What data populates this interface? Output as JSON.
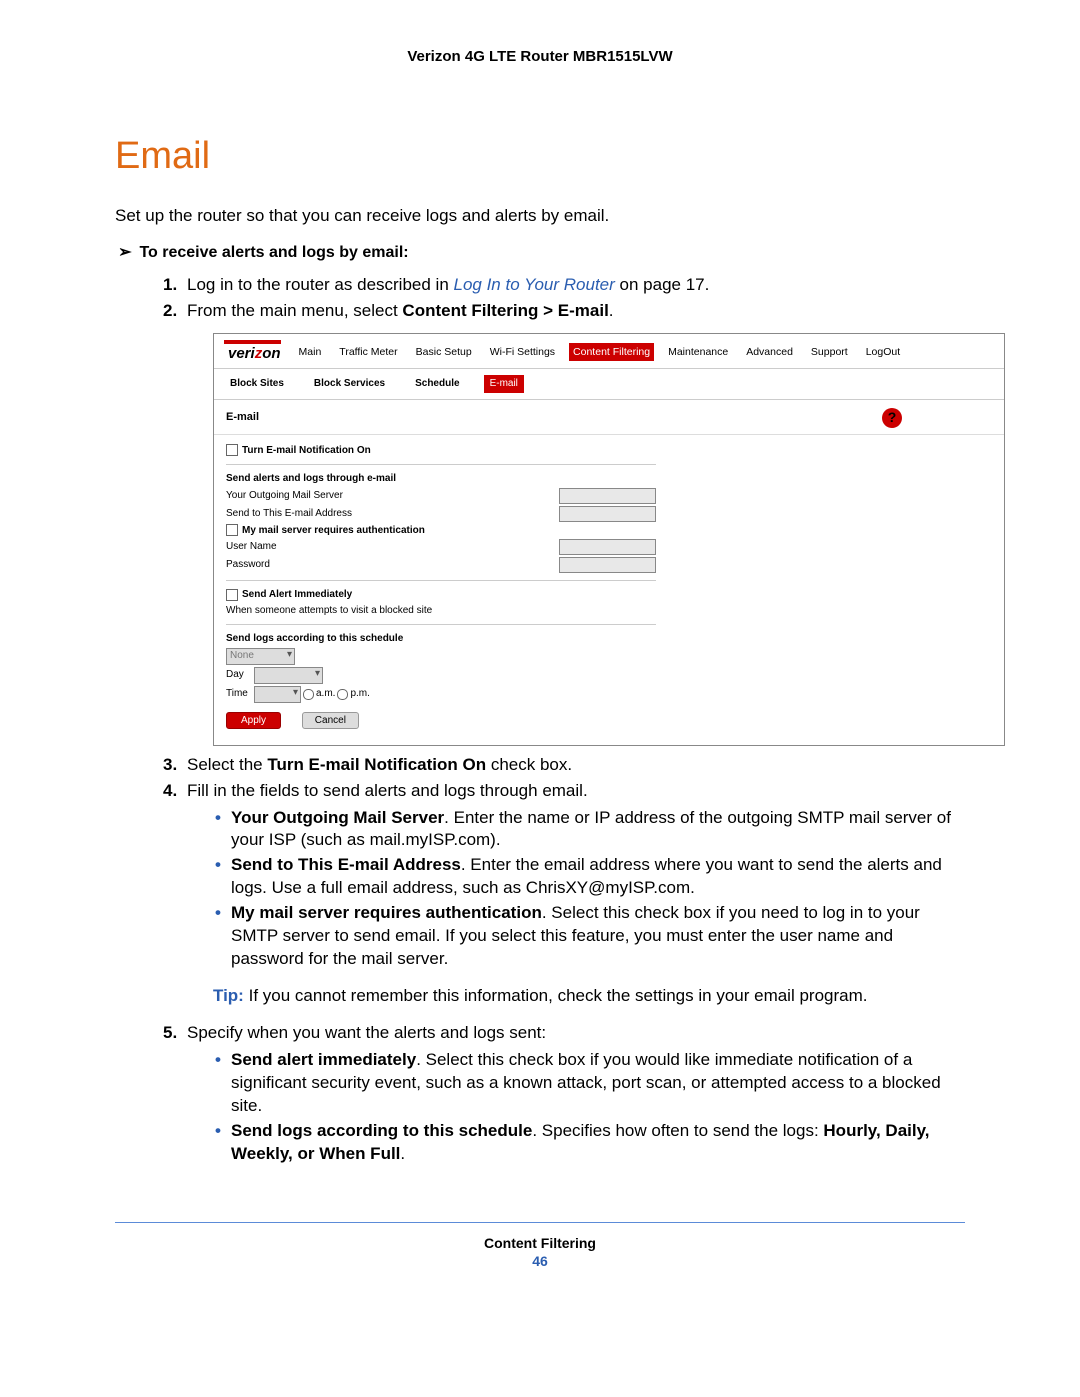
{
  "doc_header": "Verizon 4G LTE Router MBR1515LVW",
  "title": "Email",
  "intro": "Set up the router so that you can receive logs and alerts by email.",
  "task_heading": "To receive alerts and logs by email:",
  "steps": {
    "s1_a": "Log in to the router as described in ",
    "s1_link": "Log In to Your Router",
    "s1_b": " on page 17.",
    "s2_a": "From the main menu, select ",
    "s2_bold": "Content Filtering > E-mail",
    "s2_b": ".",
    "s3_a": "Select the ",
    "s3_bold": "Turn E-mail Notification On",
    "s3_b": " check box.",
    "s4": "Fill in the fields to send alerts and logs through email.",
    "s5": "Specify when you want the alerts and logs sent:"
  },
  "bullets4": {
    "b1_bold": "Your Outgoing Mail Server",
    "b1_txt": ". Enter the name or IP address of the outgoing SMTP mail server of your ISP (such as mail.myISP.com).",
    "b2_bold": "Send to This E-mail Address",
    "b2_txt": ". Enter the email address where you want to send the alerts and logs. Use a full email address, such as ChrisXY@myISP.com.",
    "b3_bold": "My mail server requires authentication",
    "b3_txt": ". Select this check box if you need to log in to your SMTP server to send email. If you select this feature, you must enter the user name and password for the mail server."
  },
  "tip_label": "Tip:",
  "tip_text": "If you cannot remember this information, check the settings in your email program.",
  "bullets5": {
    "b1_bold": "Send alert immediately",
    "b1_txt": ". Select this check box if you would like immediate notification of a significant security event, such as a known attack, port scan, or attempted access to a blocked site.",
    "b2_bold": "Send logs according to this schedule",
    "b2_txt": ". Specifies how often to send the logs: ",
    "b2_opts": "Hourly, Daily, Weekly, or When Full"
  },
  "footer_section": "Content Filtering",
  "page_number": "46",
  "ss": {
    "logo_a": "veri",
    "logo_b": "z",
    "logo_c": "on",
    "nav": [
      "Main",
      "Traffic Meter",
      "Basic Setup",
      "Wi-Fi Settings",
      "Content Filtering",
      "Maintenance",
      "Advanced",
      "Support",
      "LogOut"
    ],
    "subnav": [
      "Block Sites",
      "Block Services",
      "Schedule",
      "E-mail"
    ],
    "panel_title": "E-mail",
    "help": "?",
    "turn_on": "Turn E-mail Notification On",
    "send_heading": "Send alerts and logs through e-mail",
    "out_server": "Your Outgoing Mail Server",
    "send_to": "Send to This E-mail Address",
    "auth": "My mail server requires authentication",
    "user": "User Name",
    "pass": "Password",
    "alert_imm": "Send Alert Immediately",
    "alert_desc": "When someone attempts to visit a blocked site",
    "sched_heading": "Send logs according to this schedule",
    "sched_none": "None",
    "day": "Day",
    "time": "Time",
    "am": "a.m.",
    "pm": "p.m.",
    "apply": "Apply",
    "cancel": "Cancel"
  }
}
